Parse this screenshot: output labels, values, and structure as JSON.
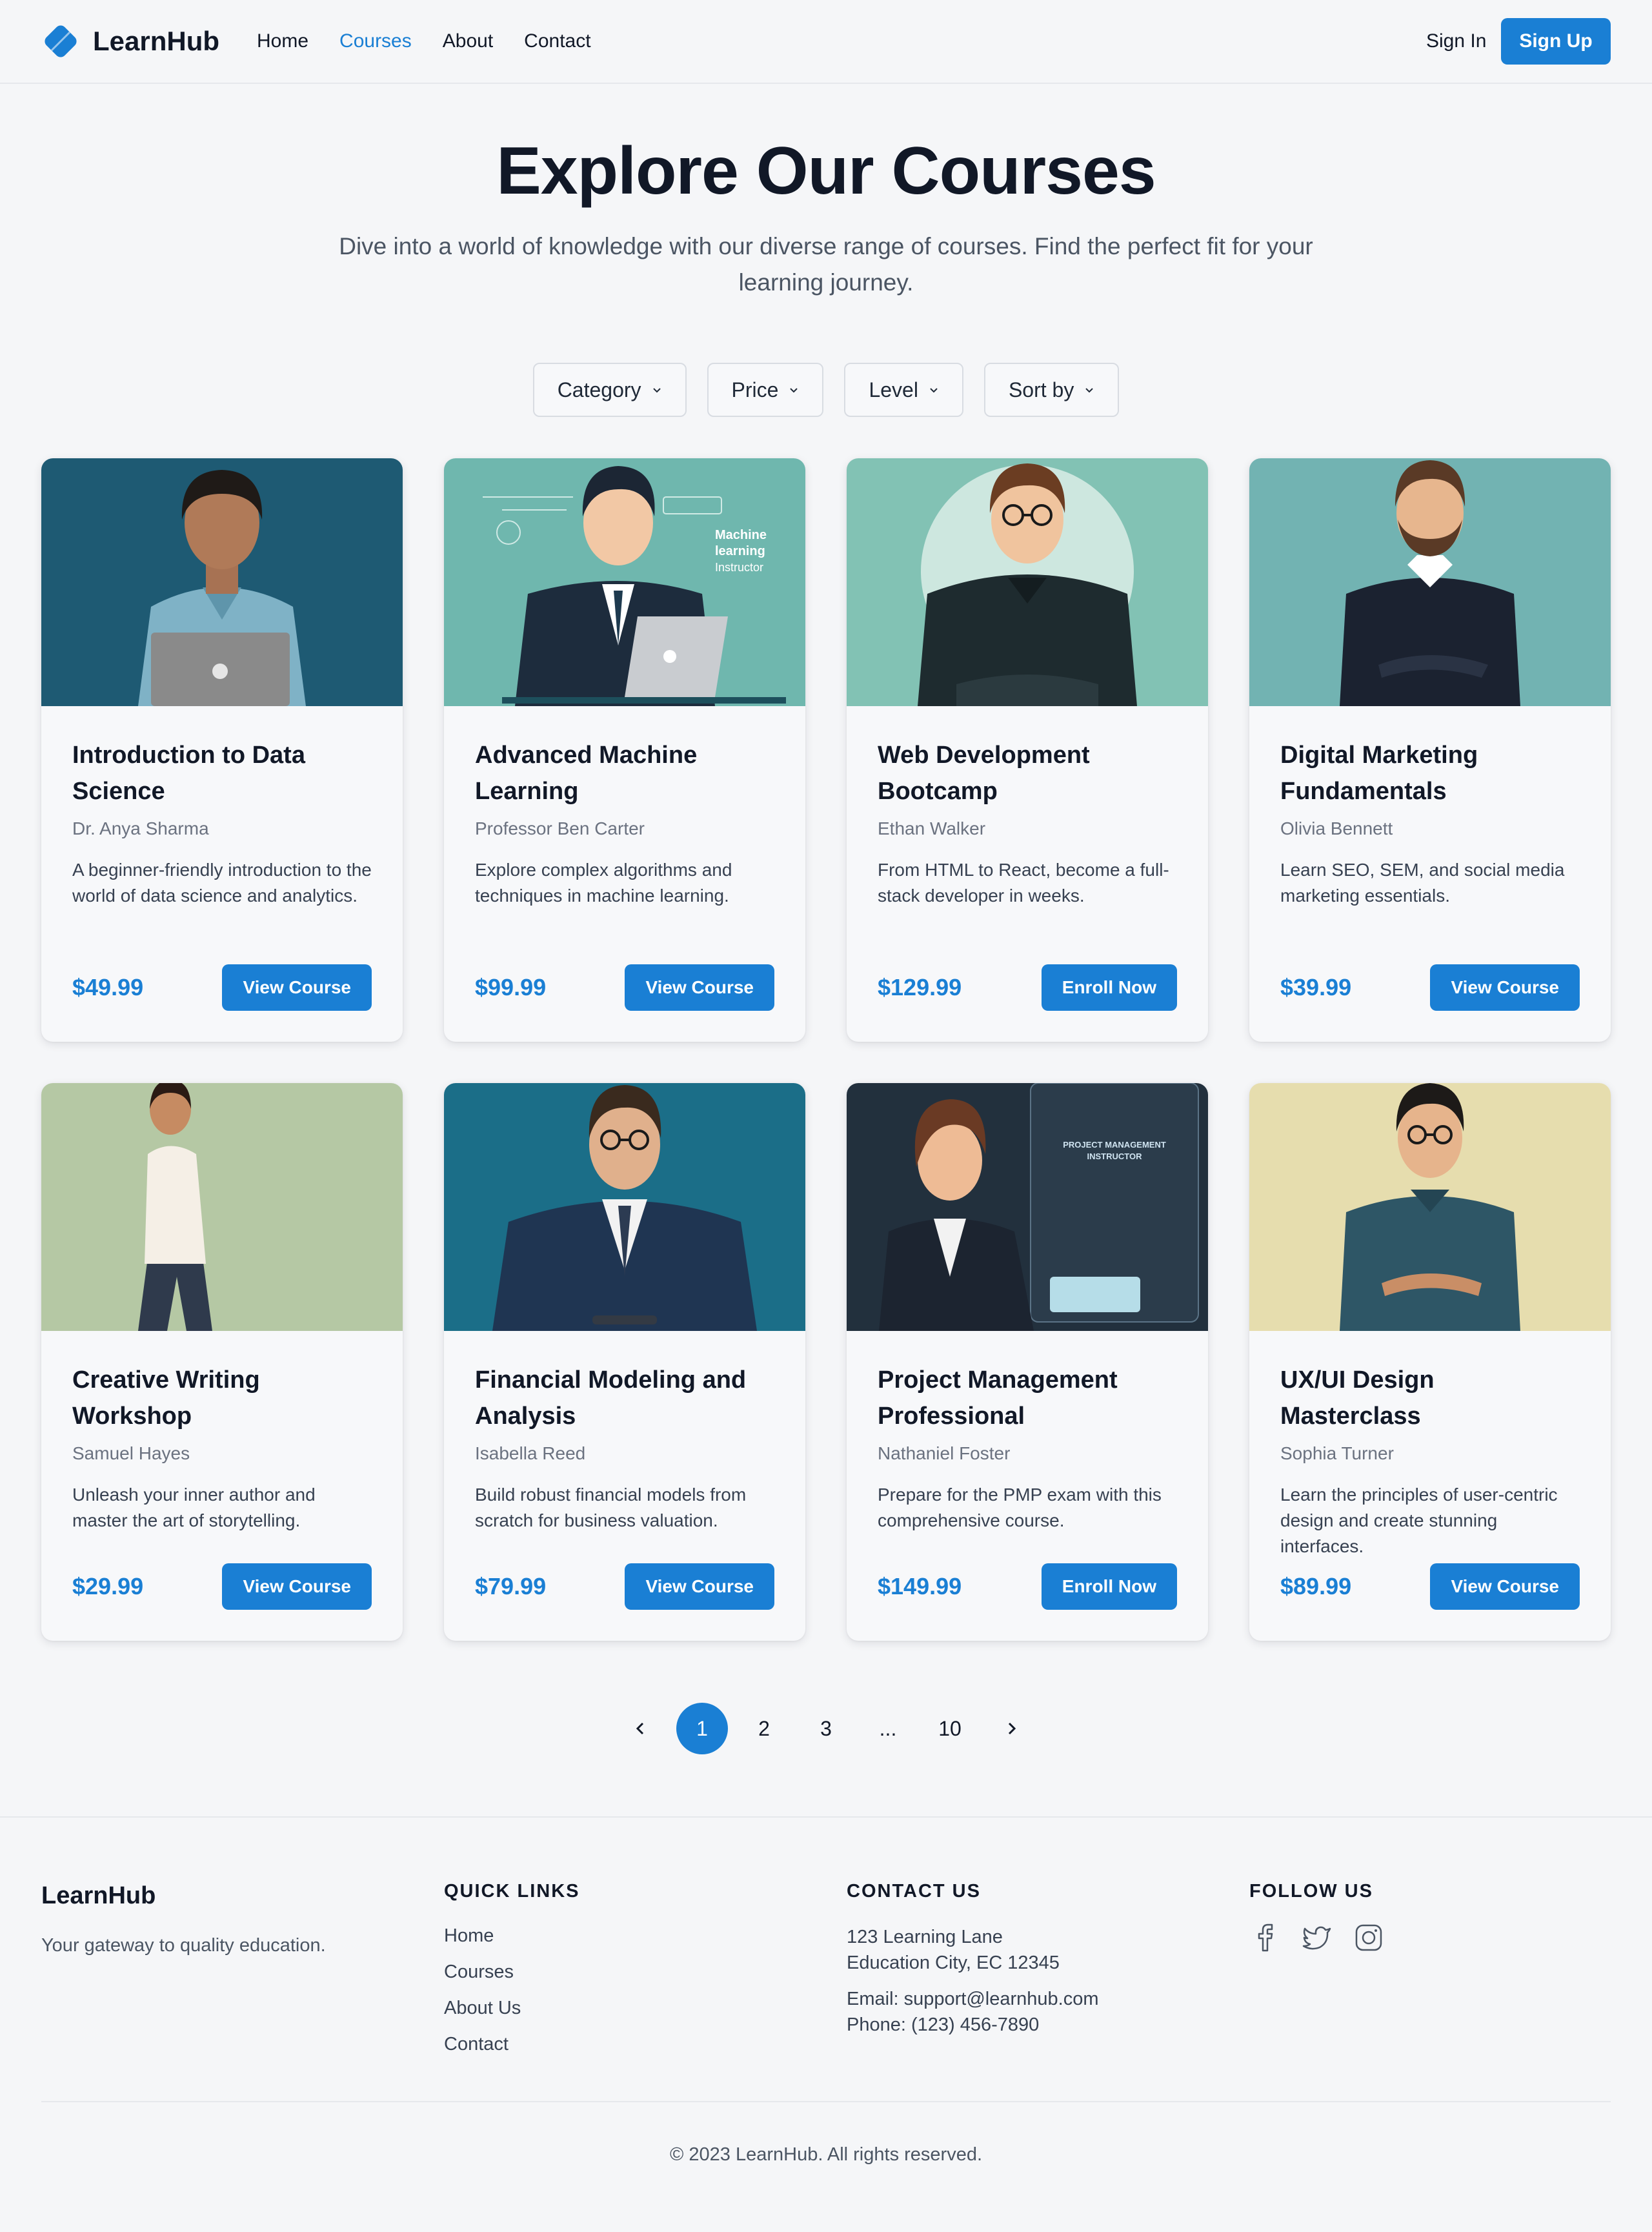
{
  "brand": {
    "name": "LearnHub",
    "accent": "#1a7fd4"
  },
  "nav": {
    "items": [
      {
        "label": "Home"
      },
      {
        "label": "Courses",
        "active": true
      },
      {
        "label": "About"
      },
      {
        "label": "Contact"
      }
    ],
    "signin": "Sign In",
    "signup": "Sign Up"
  },
  "hero": {
    "title": "Explore Our Courses",
    "subtitle": "Dive into a world of knowledge with our diverse range of courses. Find the perfect fit for your learning journey."
  },
  "filters": [
    "Category",
    "Price",
    "Level",
    "Sort by"
  ],
  "courses": [
    {
      "title": "Introduction to Data Science",
      "instructor": "Dr. Anya Sharma",
      "description": "A beginner-friendly introduction to the world of data science and analytics.",
      "price": "$49.99",
      "button": "View Course",
      "image_bg": "#1e5a73"
    },
    {
      "title": "Advanced Machine Learning",
      "instructor": "Professor Ben Carter",
      "description": "Explore complex algorithms and techniques in machine learning.",
      "price": "$99.99",
      "button": "View Course",
      "image_bg": "#6fb7ae",
      "image_caption": "Machine learning Instructor"
    },
    {
      "title": "Web Development Bootcamp",
      "instructor": "Ethan Walker",
      "description": "From HTML to React, become a full-stack developer in weeks.",
      "price": "$129.99",
      "button": "Enroll Now",
      "image_bg": "#82c2b4"
    },
    {
      "title": "Digital Marketing Fundamentals",
      "instructor": "Olivia Bennett",
      "description": "Learn SEO, SEM, and social media marketing essentials.",
      "price": "$39.99",
      "button": "View Course",
      "image_bg": "#72b3b2"
    },
    {
      "title": "Creative Writing Workshop",
      "instructor": "Samuel Hayes",
      "description": "Unleash your inner author and master the art of storytelling.",
      "price": "$29.99",
      "button": "View Course",
      "image_bg": "#b5c8a4"
    },
    {
      "title": "Financial Modeling and Analysis",
      "instructor": "Isabella Reed",
      "description": "Build robust financial models from scratch for business valuation.",
      "price": "$79.99",
      "button": "View Course",
      "image_bg": "#1b6e88"
    },
    {
      "title": "Project Management Professional",
      "instructor": "Nathaniel Foster",
      "description": "Prepare for the PMP exam with this comprehensive course.",
      "price": "$149.99",
      "button": "Enroll Now",
      "image_bg": "#22303d",
      "image_caption": "PROJECT MANAGEMENT INSTRUCTOR"
    },
    {
      "title": "UX/UI Design Masterclass",
      "instructor": "Sophia Turner",
      "description": "Learn the principles of user-centric design and create stunning interfaces.",
      "price": "$89.99",
      "button": "View Course",
      "image_bg": "#e6ddae"
    }
  ],
  "pagination": {
    "pages": [
      "1",
      "2",
      "3",
      "...",
      "10"
    ],
    "current": "1"
  },
  "footer": {
    "brand": "LearnHub",
    "tagline": "Your gateway to quality education.",
    "quick_links": {
      "heading": "QUICK LINKS",
      "items": [
        "Home",
        "Courses",
        "About Us",
        "Contact"
      ]
    },
    "contact": {
      "heading": "CONTACT US",
      "address_line1": "123 Learning Lane",
      "address_line2": "Education City, EC 12345",
      "email": "Email: support@learnhub.com",
      "phone": "Phone: (123) 456-7890"
    },
    "follow": {
      "heading": "FOLLOW US",
      "icons": [
        "facebook-icon",
        "twitter-icon",
        "instagram-icon"
      ]
    },
    "copyright": "© 2023 LearnHub. All rights reserved."
  }
}
